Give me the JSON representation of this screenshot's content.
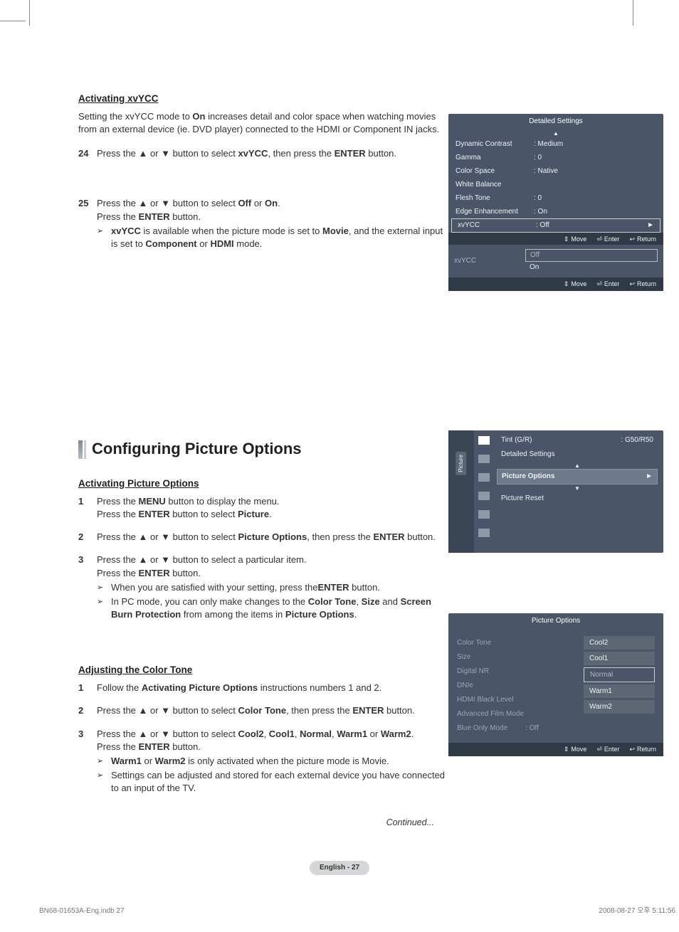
{
  "headings": {
    "activating_xvycc": "Activating xvYCC",
    "config_picture_options": "Configuring Picture Options",
    "activating_picture_options": "Activating Picture Options",
    "adjusting_color_tone": "Adjusting the Color Tone"
  },
  "body": {
    "xvycc_intro_1": "Setting the xvYCC mode to ",
    "xvycc_intro_on": "On",
    "xvycc_intro_2": " increases detail and color space when watching movies from an external device (ie. DVD player) connected to the HDMI or Component IN jacks.",
    "s24_a": "Press the ▲ or ▼ button to select ",
    "s24_b": "xvYCC",
    "s24_c": ", then press the ",
    "s24_d": "ENTER",
    "s24_e": " button.",
    "s25_a": "Press the ▲ or ▼ button to select ",
    "s25_off": "Off",
    "s25_or": " or ",
    "s25_on": "On",
    "s25_dot": ".",
    "s25_press": "Press the ",
    "s25_enter": "ENTER",
    "s25_button": " button.",
    "s25_note_a": "xvYCC",
    "s25_note_b": " is available when the picture mode is set to ",
    "s25_note_c": "Movie",
    "s25_note_d": ", and the external input is set to ",
    "s25_note_e": "Component",
    "s25_note_f": " or ",
    "s25_note_g": "HDMI",
    "s25_note_h": " mode.",
    "apo1_a": "Press the ",
    "apo1_menu": "MENU",
    "apo1_b": " button to display the menu.",
    "apo1_c": "Press the ",
    "apo1_enter": "ENTER",
    "apo1_d": " button to select ",
    "apo1_pic": "Picture",
    "apo1_dot": ".",
    "apo2_a": "Press the ▲ or ▼ button to select ",
    "apo2_po": "Picture Options",
    "apo2_b": ", then press the ",
    "apo2_enter": "ENTER",
    "apo2_c": " button.",
    "apo3_a": "Press the ▲ or ▼ button to select a particular item.",
    "apo3_b": "Press the ",
    "apo3_enter": "ENTER",
    "apo3_c": " button.",
    "apo3_note1_a": "When you are satisfied with your setting, press the",
    "apo3_note1_b": "ENTER",
    "apo3_note1_c": " button.",
    "apo3_note2_a": "In PC mode, you can only make changes to the ",
    "apo3_note2_b": "Color Tone",
    "apo3_note2_c": ", ",
    "apo3_note2_d": "Size",
    "apo3_note2_e": " and ",
    "apo3_note2_f": "Screen Burn Protection",
    "apo3_note2_g": " from among the items in ",
    "apo3_note2_h": "Picture Options",
    "apo3_note2_i": ".",
    "act1_a": "Follow the ",
    "act1_b": "Activating Picture Options",
    "act1_c": " instructions numbers 1 and 2.",
    "act2_a": "Press the ▲ or ▼ button to select ",
    "act2_b": "Color Tone",
    "act2_c": ", then press the ",
    "act2_enter": "ENTER",
    "act2_d": " button.",
    "act3_a": "Press the ▲ or ▼ button to select ",
    "act3_cool2": "Cool2",
    "act3_c1": ", ",
    "act3_cool1": "Cool1",
    "act3_c2": ", ",
    "act3_normal": "Normal",
    "act3_c3": ", ",
    "act3_warm1": "Warm1",
    "act3_or": " or ",
    "act3_warm2": "Warm2",
    "act3_dot": ".",
    "act3_b": "Press the ",
    "act3_enter": "ENTER",
    "act3_btn": " button.",
    "act3_n1_a": "Warm1",
    "act3_n1_or": " or ",
    "act3_n1_b": "Warm2",
    "act3_n1_c": " is only activated when the picture mode is Movie.",
    "act3_n2": "Settings can be adjusted and stored for each external device you have connected to an input of the TV.",
    "continued": "Continued..."
  },
  "step_nums": {
    "n24": "24",
    "n25": "25",
    "n1a": "1",
    "n2a": "2",
    "n3a": "3",
    "n1b": "1",
    "n2b": "2",
    "n3b": "3"
  },
  "osd1": {
    "title": "Detailed Settings",
    "rows": {
      "dynamic_contrast": "Dynamic Contrast",
      "dynamic_contrast_v": ": Medium",
      "gamma": "Gamma",
      "gamma_v": ": 0",
      "color_space": "Color Space",
      "color_space_v": ": Native",
      "white_balance": "White Balance",
      "flesh_tone": "Flesh Tone",
      "flesh_tone_v": ": 0",
      "edge": "Edge Enhancement",
      "edge_v": ": On",
      "xvycc": "xvYCC",
      "xvycc_v": ": Off"
    }
  },
  "osd2": {
    "label": "xvYCC",
    "off": "Off",
    "on": "On"
  },
  "osd3": {
    "sidelabel": "Picture",
    "tint": "Tint (G/R)",
    "tint_v": ": G50/R50",
    "detailed": "Detailed Settings",
    "picture_options": "Picture Options",
    "picture_reset": "Picture Reset"
  },
  "osd4": {
    "title": "Picture Options",
    "left": {
      "color_tone": "Color Tone",
      "size": "Size",
      "digital_nr": "Digital NR",
      "dnle": "DNIe",
      "hdmi_black": "HDMI Black Level",
      "adv_film": "Advanced Film Mode",
      "blue_only": "Blue Only Mode",
      "blue_only_v": ": Off"
    },
    "right": {
      "cool2": "Cool2",
      "cool1": "Cool1",
      "normal": "Normal",
      "warm1": "Warm1",
      "warm2": "Warm2"
    }
  },
  "footer_hints": {
    "move": "Move",
    "enter": "Enter",
    "return_": "Return"
  },
  "pager": "English - 27",
  "print_footer_left": "BN68-01653A-Eng.indb   27",
  "print_footer_right": "2008-08-27   오후 5:11:56"
}
